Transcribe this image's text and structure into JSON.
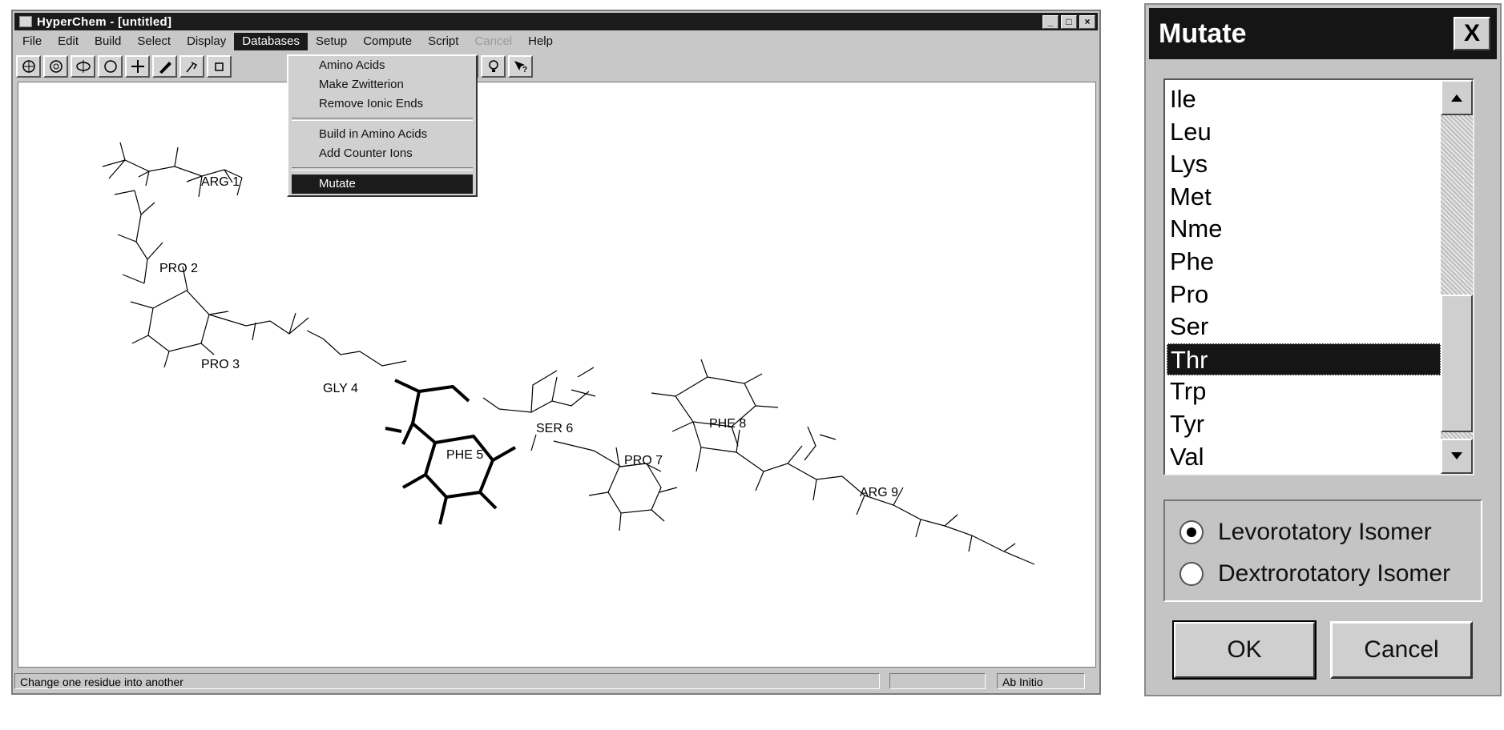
{
  "window": {
    "title": "HyperChem - [untitled]",
    "controls": [
      "_",
      "□",
      "×"
    ]
  },
  "menubar": {
    "items": [
      {
        "label": "File"
      },
      {
        "label": "Edit"
      },
      {
        "label": "Build"
      },
      {
        "label": "Select"
      },
      {
        "label": "Display"
      },
      {
        "label": "Databases",
        "active": true
      },
      {
        "label": "Setup"
      },
      {
        "label": "Compute"
      },
      {
        "label": "Script"
      },
      {
        "label": "Cancel",
        "disabled": true
      },
      {
        "label": "Help"
      }
    ]
  },
  "databases_menu": {
    "items": [
      {
        "label": "Amino Acids"
      },
      {
        "label": "Make Zwitterion"
      },
      {
        "label": "Remove Ionic Ends"
      },
      {
        "separator": true
      },
      {
        "label": "Build in Amino Acids"
      },
      {
        "label": "Add Counter Ions"
      },
      {
        "separator": true
      },
      {
        "label": "Mutate",
        "selected": true
      }
    ]
  },
  "molecule": {
    "residue_labels": [
      "ARG 1",
      "PRO 2",
      "PRO 3",
      "GLY 4",
      "PHE 5",
      "SER 6",
      "PRO 7",
      "PHE 8",
      "ARG 9"
    ]
  },
  "statusbar": {
    "message": "Change one residue into another",
    "method": "Ab Initio"
  },
  "dialog": {
    "title": "Mutate",
    "close": "X",
    "list": [
      "Ile",
      "Leu",
      "Lys",
      "Met",
      "Nme",
      "Phe",
      "Pro",
      "Ser",
      "Thr",
      "Trp",
      "Tyr",
      "Val"
    ],
    "selected_item": "Thr",
    "radio_levo": "Levorotatory Isomer",
    "radio_dextro": "Dextrorotatory Isomer",
    "radio_selected": "Levorotatory Isomer",
    "ok": "OK",
    "cancel": "Cancel"
  }
}
